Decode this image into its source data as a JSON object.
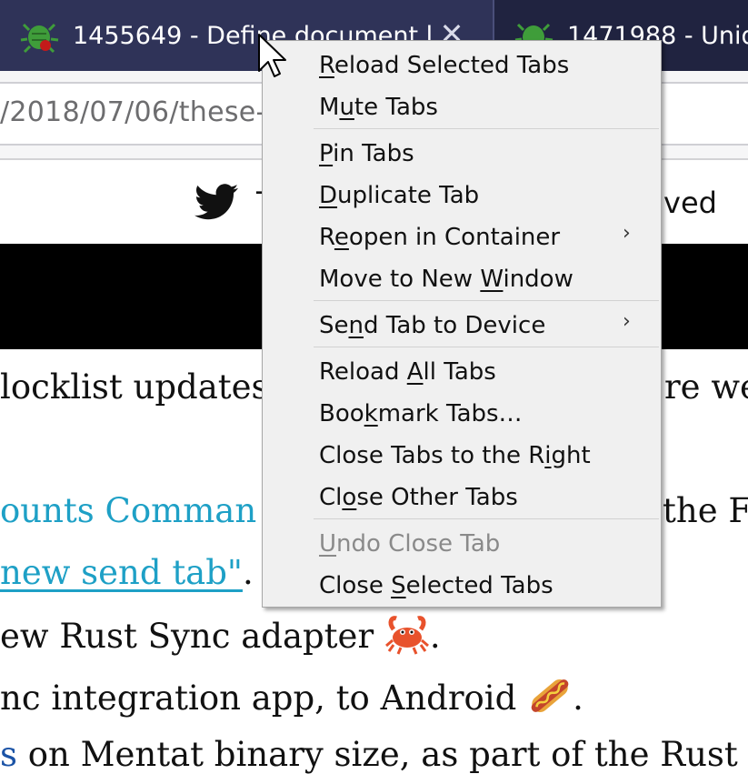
{
  "tabs": [
    {
      "title": "1455649 - Define document.l",
      "close": "✕"
    },
    {
      "title": "1471988 - Uniq"
    }
  ],
  "urlbar": {
    "url": "/2018/07/06/these-"
  },
  "page": {
    "header_fragment": "T",
    "header_right": "ved",
    "lines": {
      "l1_left": "locklist updates",
      "l1_right": "re we",
      "l2_link": "ounts Comman",
      "l2_right": "the F",
      "l3_link": "new send tab\"",
      "l3_after": ".",
      "l4_text": "ew Rust Sync adapter",
      "l4_after": ".",
      "l5_text": "nc integration app, to Android",
      "l5_after": ".",
      "l6_link": "s",
      "l6_text": " on Mentat binary size, as part of the Rust"
    }
  },
  "context_menu": {
    "items": [
      {
        "label": "Reload Selected Tabs",
        "pre": "",
        "key": "R",
        "post": "eload Selected Tabs"
      },
      {
        "label": "Mute Tabs",
        "pre": "M",
        "key": "u",
        "post": "te Tabs"
      },
      {
        "label": "Pin Tabs",
        "pre": "",
        "key": "P",
        "post": "in Tabs"
      },
      {
        "label": "Duplicate Tab",
        "pre": "",
        "key": "D",
        "post": "uplicate Tab"
      },
      {
        "label": "Reopen in Container",
        "pre": "R",
        "key": "e",
        "post": "open in Container",
        "submenu": "›"
      },
      {
        "label": "Move to New Window",
        "pre": "Move to New ",
        "key": "W",
        "post": "indow"
      },
      {
        "label": "Send Tab to Device",
        "pre": "Se",
        "key": "n",
        "post": "d Tab to Device",
        "submenu": "›"
      },
      {
        "label": "Reload All Tabs",
        "pre": "Reload ",
        "key": "A",
        "post": "ll Tabs"
      },
      {
        "label": "Bookmark Tabs…",
        "pre": "Boo",
        "key": "k",
        "post": "mark Tabs…"
      },
      {
        "label": "Close Tabs to the Right",
        "pre": "Close Tabs to the R",
        "key": "i",
        "post": "ght"
      },
      {
        "label": "Close Other Tabs",
        "pre": "Cl",
        "key": "o",
        "post": "se Other Tabs"
      },
      {
        "label": "Undo Close Tab",
        "pre": "",
        "key": "U",
        "post": "ndo Close Tab",
        "disabled": true
      },
      {
        "label": "Close Selected Tabs",
        "pre": "Close ",
        "key": "S",
        "post": "elected Tabs"
      }
    ]
  },
  "colors": {
    "tabstrip": "#202340",
    "active_tab": "#2f3358",
    "link": "#1ea0c6",
    "menu_bg": "#f0f0f0"
  },
  "icons": {
    "favicon": "bug-favicon-icon",
    "close": "close-icon",
    "social": "twitter-icon",
    "submenu": "chevron-right-icon",
    "emoji1": "crab-emoji",
    "emoji2": "hotdog-emoji",
    "cursor": "mouse-pointer-icon"
  }
}
